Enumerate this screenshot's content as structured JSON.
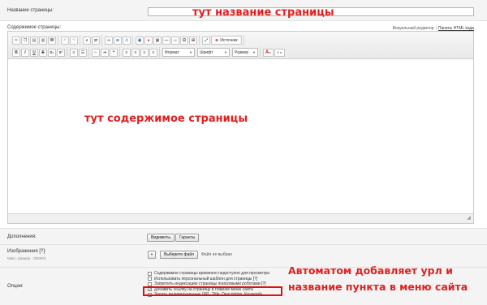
{
  "page_title_row": {
    "label": "Название страницы:",
    "input_value": ""
  },
  "annotations": {
    "title_note": "тут название страницы",
    "content_note": "тут содержимое страницы",
    "options_note": "Автоматом добавляет урл и название пункта в меню сайта"
  },
  "content": {
    "label": "Содержимое страницы:",
    "visual_editor_label": "Визуальный редактор",
    "html_code_label": "Панель HTML кода",
    "separator": "|"
  },
  "toolbar": {
    "row1_icons": [
      "cut-icon",
      "copy-icon",
      "paste-icon",
      "paste-text-icon",
      "paste-word-icon",
      "undo-icon",
      "redo-icon",
      "find-icon",
      "replace-icon",
      "link-icon",
      "unlink-icon",
      "anchor-icon",
      "image-icon",
      "flash-icon",
      "table-icon",
      "hr-icon",
      "smiley-icon",
      "special-char-icon",
      "page-break-icon",
      "maximize-icon"
    ],
    "source_label": "Источник",
    "row2_buttons": [
      "B",
      "I",
      "U",
      "S",
      "x₂",
      "x²"
    ],
    "format_label": "Формат",
    "font_label": "Шрифт",
    "size_label": "Размер",
    "text_color_glyph": "A",
    "bg_color_glyph": "◐"
  },
  "extra": {
    "label": "Дополнения:",
    "show_label": "Видимиты",
    "hide_label": "Гаранты"
  },
  "images": {
    "label": "Изображения [?]:",
    "max_size": "Макс. размер - 2000Kb",
    "plus_label": "+",
    "choose_file_label": "Выберите файл",
    "no_file_label": "Файл не выбран"
  },
  "options": {
    "label": "Опции:",
    "items": [
      {
        "text": "Содержимое страницы временно недоступно для просмотра",
        "checked": false
      },
      {
        "text": "Использовать персональный шаблон для страницы [?]",
        "checked": false
      },
      {
        "text": "Запретить индексацию страницы поисковыми роботами [?]",
        "checked": false
      },
      {
        "text": "Добавить ссылку на страницу в главное меню сайта",
        "checked": true
      },
      {
        "text": "Задать индивидуальные URL, Title, Description, Keywords",
        "checked": false
      }
    ]
  }
}
